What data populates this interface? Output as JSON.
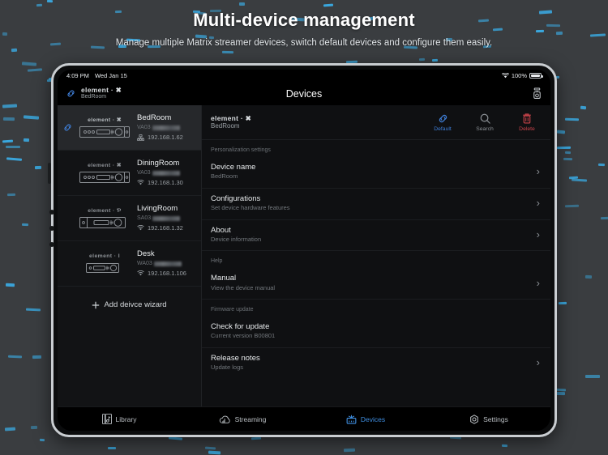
{
  "promo": {
    "title": "Multi-device management",
    "subtitle": "Manage multiple Matrix streamer devices, switch default devices and configure them easily."
  },
  "statusbar": {
    "time": "4:09 PM",
    "date": "Wed Jan 15",
    "wifi_icon": "wifi-icon",
    "battery_percent": "100%",
    "battery_icon": "battery-full-icon"
  },
  "navbar": {
    "brand": "element · ✖",
    "brand_sub": "BedRoom",
    "link_icon": "link-icon",
    "title": "Devices",
    "cast_icon": "cast-speaker-icon"
  },
  "devices": {
    "items": [
      {
        "model": "element · ✖",
        "name": "BedRoom",
        "serial_prefix": "VA03",
        "ip": "192.168.1.62",
        "connection_icon": "ethernet-icon",
        "selected": true,
        "link_icon": "link-icon",
        "panel": "full"
      },
      {
        "model": "element · ✖",
        "name": "DiningRoom",
        "serial_prefix": "VA03",
        "ip": "192.168.1.30",
        "connection_icon": "wifi-icon",
        "selected": false,
        "link_icon": "",
        "panel": "full"
      },
      {
        "model": "element · Ƥ",
        "name": "LivingRoom",
        "serial_prefix": "SA03",
        "ip": "192.168.1.32",
        "connection_icon": "wifi-icon",
        "selected": false,
        "link_icon": "",
        "panel": "mid"
      },
      {
        "model": "element · I",
        "name": "Desk",
        "serial_prefix": "WA03",
        "ip": "192.168.1.106",
        "connection_icon": "wifi-icon",
        "selected": false,
        "link_icon": "",
        "panel": "small"
      }
    ],
    "add_wizard_label": "Add deivce wizard",
    "add_icon": "plus-icon"
  },
  "detail": {
    "header": {
      "title": "element · ✖",
      "subtitle": "BedRoom",
      "actions": [
        {
          "label": "Default",
          "icon": "link-icon",
          "color": "#3f7fd8"
        },
        {
          "label": "Search",
          "icon": "search-icon",
          "color": "#8b9095"
        },
        {
          "label": "Delete",
          "icon": "trash-icon",
          "color": "#c8434a"
        }
      ]
    },
    "sections": [
      {
        "label": "Personalization settings",
        "rows": [
          {
            "title": "Device name",
            "sub": "BedRoom",
            "chevron": true
          },
          {
            "title": "Configurations",
            "sub": "Set device hardware features",
            "chevron": true
          },
          {
            "title": "About",
            "sub": "Device information",
            "chevron": true
          }
        ]
      },
      {
        "label": "Help",
        "rows": [
          {
            "title": "Manual",
            "sub": "View the device manual",
            "chevron": true
          }
        ]
      },
      {
        "label": "Firmware update",
        "rows": [
          {
            "title": "Check for update",
            "sub": "Current version B00801",
            "chevron": false
          },
          {
            "title": "Release notes",
            "sub": "Update logs",
            "chevron": true
          }
        ]
      }
    ]
  },
  "tabbar": {
    "tabs": [
      {
        "label": "Library",
        "icon": "library-icon",
        "active": false
      },
      {
        "label": "Streaming",
        "icon": "cloud-icon",
        "active": false
      },
      {
        "label": "Devices",
        "icon": "devices-icon",
        "active": true
      },
      {
        "label": "Settings",
        "icon": "gear-icon",
        "active": false
      }
    ]
  },
  "colors": {
    "accent": "#3f8ee0",
    "danger": "#c8434a",
    "background": "#3a3d40",
    "dash": "#3aa9e0"
  }
}
